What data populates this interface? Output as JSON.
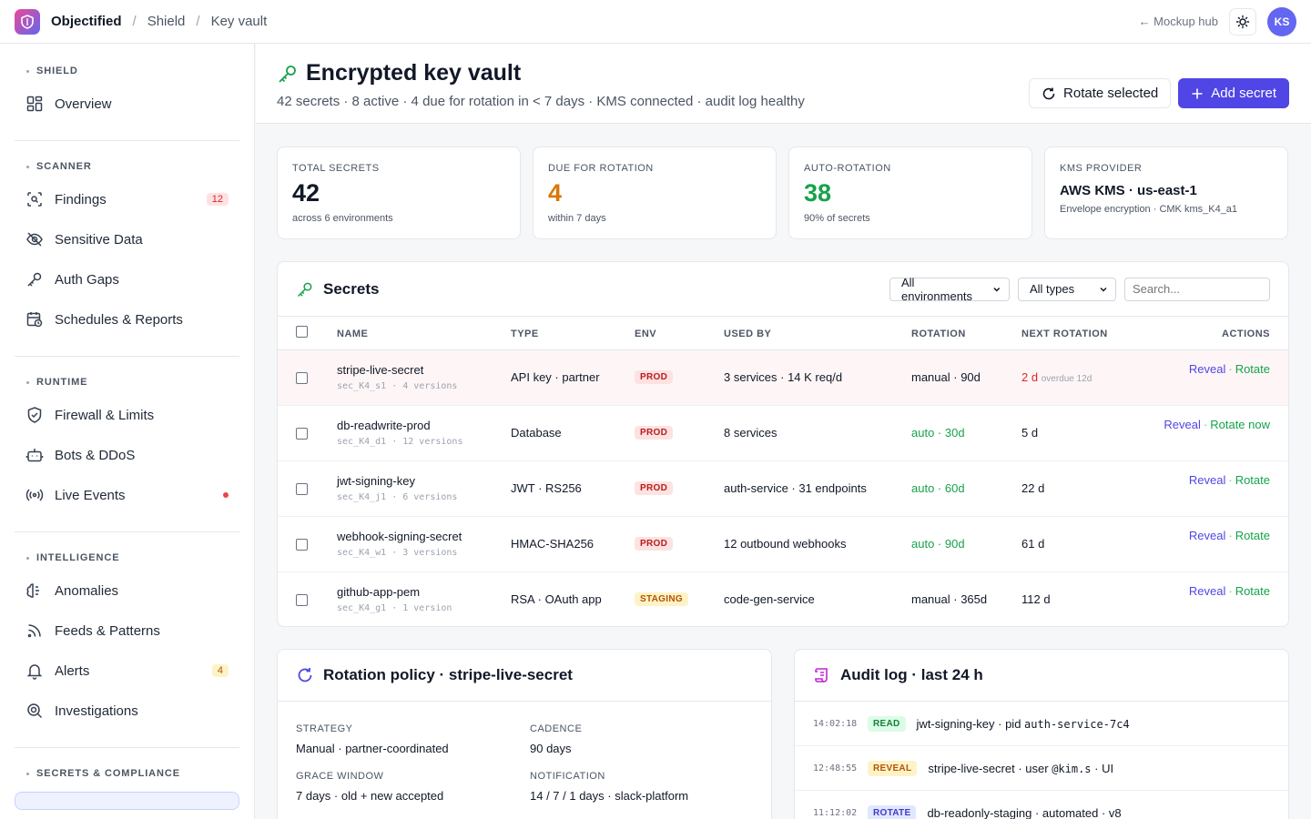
{
  "topbar": {
    "brand": "Objectified",
    "crumbs": [
      "Shield",
      "Key vault"
    ],
    "hub_link": "← Mockup hub",
    "avatar": "KS"
  },
  "sidebar": {
    "sections": [
      {
        "title": "SHIELD",
        "items": [
          {
            "label": "Overview",
            "icon": "grid-icon"
          }
        ]
      },
      {
        "title": "SCANNER",
        "items": [
          {
            "label": "Findings",
            "icon": "scan-icon",
            "badge": "12"
          },
          {
            "label": "Sensitive Data",
            "icon": "eye-off-icon"
          },
          {
            "label": "Auth Gaps",
            "icon": "key-icon"
          },
          {
            "label": "Schedules & Reports",
            "icon": "calendar-clock-icon"
          }
        ]
      },
      {
        "title": "RUNTIME",
        "items": [
          {
            "label": "Firewall & Limits",
            "icon": "shield-icon"
          },
          {
            "label": "Bots & DDoS",
            "icon": "bot-icon"
          },
          {
            "label": "Live Events",
            "icon": "radio-icon",
            "live": true
          }
        ]
      },
      {
        "title": "INTELLIGENCE",
        "items": [
          {
            "label": "Anomalies",
            "icon": "brain-icon"
          },
          {
            "label": "Feeds & Patterns",
            "icon": "rss-icon"
          },
          {
            "label": "Alerts",
            "icon": "bell-icon",
            "badge": "4"
          },
          {
            "label": "Investigations",
            "icon": "search-icon"
          }
        ]
      },
      {
        "title": "SECRETS & COMPLIANCE",
        "items": []
      }
    ]
  },
  "header": {
    "title": "Encrypted key vault",
    "subtitle": "42 secrets · 8 active · 4 due for rotation in < 7 days · KMS connected · audit log healthy",
    "rotate_label": "Rotate selected",
    "add_label": "Add secret"
  },
  "stats": [
    {
      "label": "TOTAL SECRETS",
      "value": "42",
      "note": "across 6 environments",
      "color": "#111827"
    },
    {
      "label": "DUE FOR ROTATION",
      "value": "4",
      "note": "within 7 days",
      "color": "#d97706"
    },
    {
      "label": "AUTO-ROTATION",
      "value": "38",
      "note": "90% of secrets",
      "color": "#16a34a"
    },
    {
      "label": "KMS PROVIDER",
      "value": "AWS KMS · us-east-1",
      "note": "Envelope encryption · CMK kms_K4_a1",
      "color": "#111827"
    }
  ],
  "secrets": {
    "title": "Secrets",
    "env_filter": "All environments",
    "type_filter": "All types",
    "search_placeholder": "Search...",
    "columns": [
      "NAME",
      "TYPE",
      "ENV",
      "USED BY",
      "ROTATION",
      "NEXT ROTATION",
      "ACTIONS"
    ],
    "rows": [
      {
        "name": "stripe-live-secret",
        "meta": "sec_K4_s1 · 4 versions",
        "type": "API key · partner",
        "env": "PROD",
        "used_by": "3 services · 14 K req/d",
        "rotation": "manual · 90d",
        "rotation_auto": false,
        "next": "2 d",
        "next_note": "overdue 12d",
        "reveal": "Reveal",
        "rotate": "Rotate"
      },
      {
        "name": "db-readwrite-prod",
        "meta": "sec_K4_d1 · 12 versions",
        "type": "Database",
        "env": "PROD",
        "used_by": "8 services",
        "rotation": "auto · 30d",
        "rotation_auto": true,
        "next": "5 d",
        "next_note": "",
        "reveal": "Reveal",
        "rotate": "Rotate now"
      },
      {
        "name": "jwt-signing-key",
        "meta": "sec_K4_j1 · 6 versions",
        "type": "JWT · RS256",
        "env": "PROD",
        "used_by": "auth-service · 31 endpoints",
        "rotation": "auto · 60d",
        "rotation_auto": true,
        "next": "22 d",
        "next_note": "",
        "reveal": "Reveal",
        "rotate": "Rotate"
      },
      {
        "name": "webhook-signing-secret",
        "meta": "sec_K4_w1 · 3 versions",
        "type": "HMAC-SHA256",
        "env": "PROD",
        "used_by": "12 outbound webhooks",
        "rotation": "auto · 90d",
        "rotation_auto": true,
        "next": "61 d",
        "next_note": "",
        "reveal": "Reveal",
        "rotate": "Rotate"
      },
      {
        "name": "github-app-pem",
        "meta": "sec_K4_g1 · 1 version",
        "type": "RSA · OAuth app",
        "env": "STAGING",
        "used_by": "code-gen-service",
        "rotation": "manual · 365d",
        "rotation_auto": false,
        "next": "112 d",
        "next_note": "",
        "reveal": "Reveal",
        "rotate": "Rotate"
      }
    ]
  },
  "policy": {
    "title": "Rotation policy · stripe-live-secret",
    "fields": [
      {
        "label": "STRATEGY",
        "value": "Manual · partner-coordinated"
      },
      {
        "label": "CADENCE",
        "value": "90 days"
      },
      {
        "label": "GRACE WINDOW",
        "value": "7 days · old + new accepted"
      },
      {
        "label": "NOTIFICATION",
        "value": "14 / 7 / 1 days · slack-platform"
      }
    ]
  },
  "audit": {
    "title": "Audit log · last 24 h",
    "rows": [
      {
        "time": "14:02:18",
        "tag": "READ",
        "text_a": "jwt-signing-key · pid ",
        "code": "auth-service-7c4",
        "text_b": ""
      },
      {
        "time": "12:48:55",
        "tag": "REVEAL",
        "text_a": "stripe-live-secret · user ",
        "code": "@kim.s",
        "text_b": " · UI"
      },
      {
        "time": "11:12:02",
        "tag": "ROTATE",
        "text_a": "db-readonly-staging · automated · v8",
        "code": "",
        "text_b": ""
      }
    ]
  },
  "colors": {
    "accent": "#4f46e5",
    "success": "#16a34a",
    "warning": "#d97706",
    "danger": "#dc2626"
  }
}
